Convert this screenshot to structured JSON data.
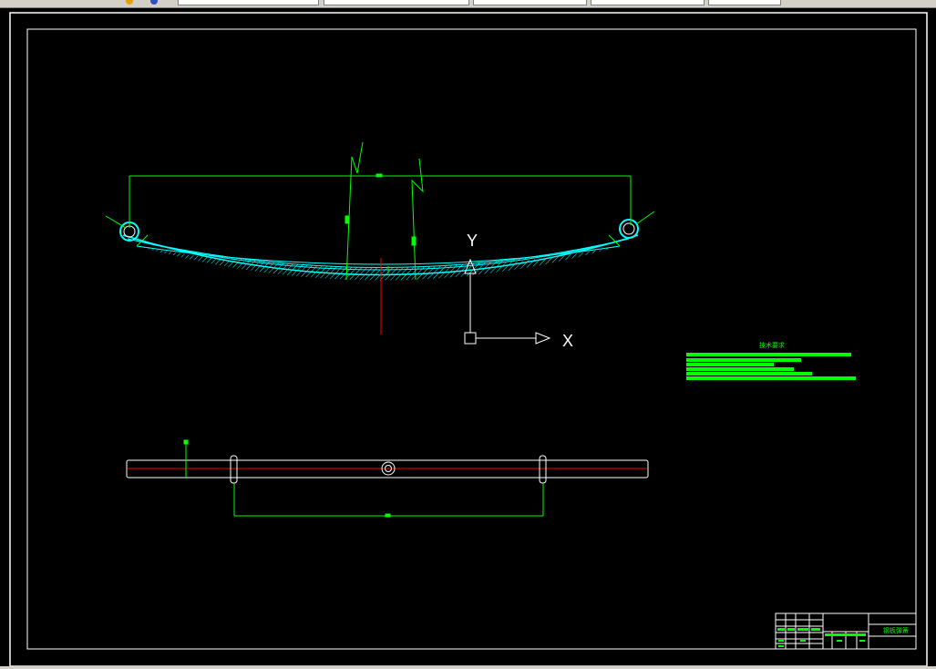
{
  "toolbar": {
    "fields": [
      "",
      "",
      "",
      "",
      ""
    ]
  },
  "drawing": {
    "ucs": {
      "x_label": "X",
      "y_label": "Y"
    },
    "notes_title": "技术要求",
    "title_block": {
      "drawing_name": "钢板弹簧"
    }
  },
  "colors": {
    "background": "#000000",
    "frame": "#ffffff",
    "dimension": "#00ff00",
    "hatch": "#00ffff",
    "centerline": "#ff0000"
  },
  "icons": [
    "ucs-icon",
    "tool-icon-1",
    "tool-icon-2"
  ]
}
